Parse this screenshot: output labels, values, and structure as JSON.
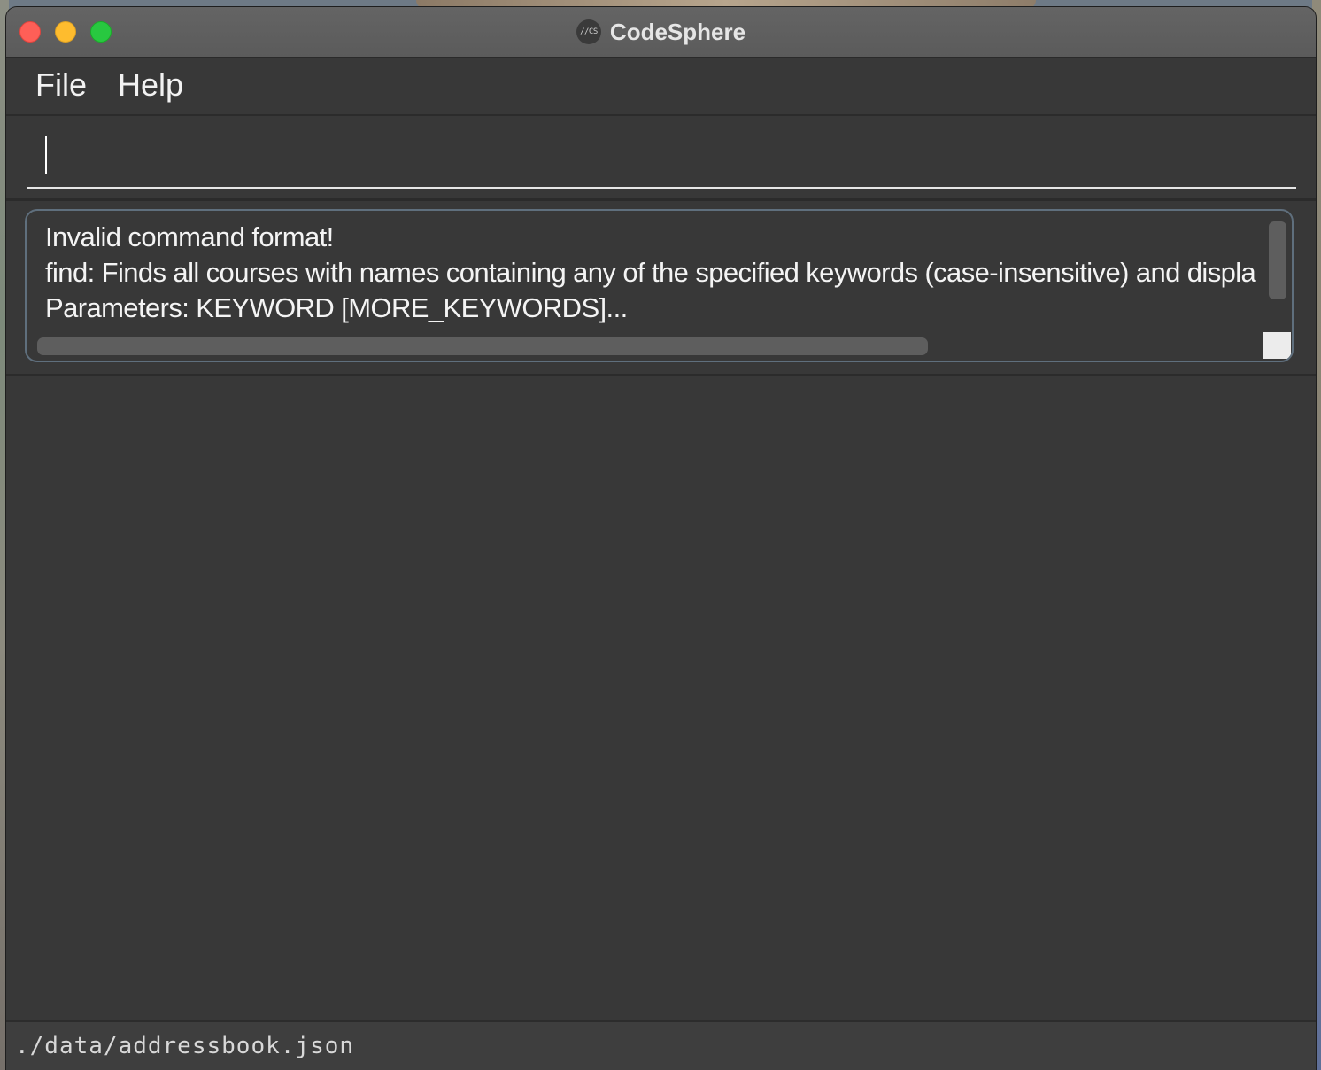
{
  "window": {
    "title": "CodeSphere",
    "app_icon_text": "//CS",
    "controls": [
      "close",
      "minimize",
      "maximize"
    ]
  },
  "menu": {
    "items": [
      {
        "label": "File"
      },
      {
        "label": "Help"
      }
    ]
  },
  "command_box": {
    "value": ""
  },
  "result_display": {
    "lines": [
      "Invalid command format!",
      "find: Finds all courses with names containing any of the specified keywords (case-insensitive) and displa",
      "Parameters: KEYWORD [MORE_KEYWORDS]..."
    ]
  },
  "status_bar": {
    "path": "./data/addressbook.json"
  },
  "colors": {
    "window_bg": "#383838",
    "titlebar": "#5e5e5e",
    "close": "#fe5f57",
    "minimize": "#febc2e",
    "maximize": "#28c840",
    "result_border": "#5f6f7d"
  }
}
